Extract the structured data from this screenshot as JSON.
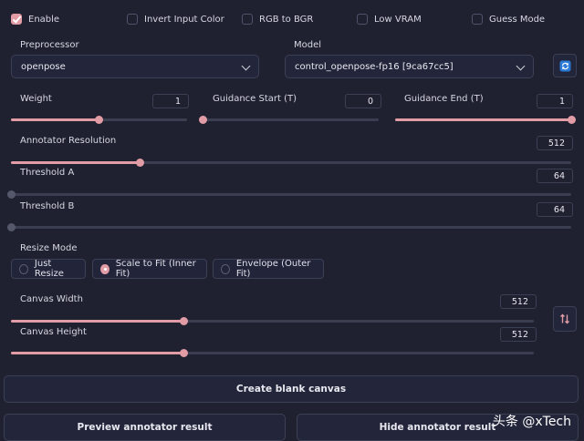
{
  "checkboxes": [
    {
      "label": "Enable",
      "checked": true
    },
    {
      "label": "Invert Input Color",
      "checked": false
    },
    {
      "label": "RGB to BGR",
      "checked": false
    },
    {
      "label": "Low VRAM",
      "checked": false
    },
    {
      "label": "Guess Mode",
      "checked": false
    }
  ],
  "preprocessor": {
    "label": "Preprocessor",
    "value": "openpose"
  },
  "model": {
    "label": "Model",
    "value": "control_openpose-fp16 [9ca67cc5]",
    "refresh_icon": "refresh-icon"
  },
  "sliders": {
    "weight": {
      "label": "Weight",
      "value": "1",
      "fraction": 0.5
    },
    "guidance_start": {
      "label": "Guidance Start (T)",
      "value": "0",
      "fraction": 0.0
    },
    "guidance_end": {
      "label": "Guidance End (T)",
      "value": "1",
      "fraction": 1.0
    },
    "annotator_resolution": {
      "label": "Annotator Resolution",
      "value": "512",
      "fraction": 0.23
    },
    "threshold_a": {
      "label": "Threshold A",
      "value": "64",
      "fraction": 0.0
    },
    "threshold_b": {
      "label": "Threshold B",
      "value": "64",
      "fraction": 0.0
    },
    "canvas_width": {
      "label": "Canvas Width",
      "value": "512",
      "fraction": 0.33
    },
    "canvas_height": {
      "label": "Canvas Height",
      "value": "512",
      "fraction": 0.33
    }
  },
  "resize_mode": {
    "label": "Resize Mode",
    "options": [
      "Just Resize",
      "Scale to Fit (Inner Fit)",
      "Envelope (Outer Fit)"
    ],
    "selected": "Scale to Fit (Inner Fit)"
  },
  "swap_icon": "swap-vertical-icon",
  "buttons": {
    "create_blank_canvas": "Create blank canvas",
    "preview_annotator": "Preview annotator result",
    "hide_annotator": "Hide annotator result"
  },
  "watermark": "头条 @xTech",
  "colors": {
    "accent": "#e29ca6",
    "background": "#1f2130"
  }
}
